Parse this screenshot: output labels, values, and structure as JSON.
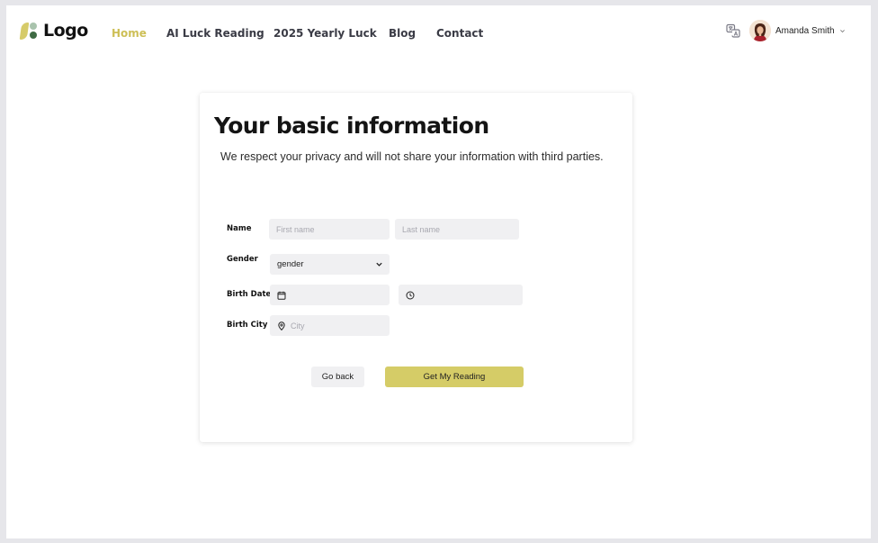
{
  "header": {
    "logo_text": "Logo",
    "nav": [
      {
        "label": "Home",
        "active": true
      },
      {
        "label": "AI Luck Reading",
        "active": false
      },
      {
        "label": "2025 Yearly Luck",
        "active": false
      },
      {
        "label": "Blog",
        "active": false
      },
      {
        "label": "Contact",
        "active": false
      }
    ],
    "language_icon": "translate-icon",
    "user": {
      "name": "Amanda Smith",
      "avatar_icon": "avatar-icon",
      "menu_icon": "chevron-down-icon"
    }
  },
  "form": {
    "title": "Your basic information",
    "subtitle": "We respect your privacy and will not share your information with third parties.",
    "name_label": "Name",
    "first_name_placeholder": "First name",
    "last_name_placeholder": "Last name",
    "gender_label": "Gender",
    "gender_value": "gender",
    "birth_date_label": "Birth Date",
    "date_icon": "calendar-icon",
    "time_icon": "clock-icon",
    "birth_city_label": "Birth City",
    "city_icon": "location-pin-icon",
    "city_placeholder": "City",
    "back_label": "Go back",
    "submit_label": "Get My Reading"
  },
  "colors": {
    "accent": "#d5cc67",
    "nav_active": "#cdbf56",
    "field_bg": "#f0f0f2"
  }
}
